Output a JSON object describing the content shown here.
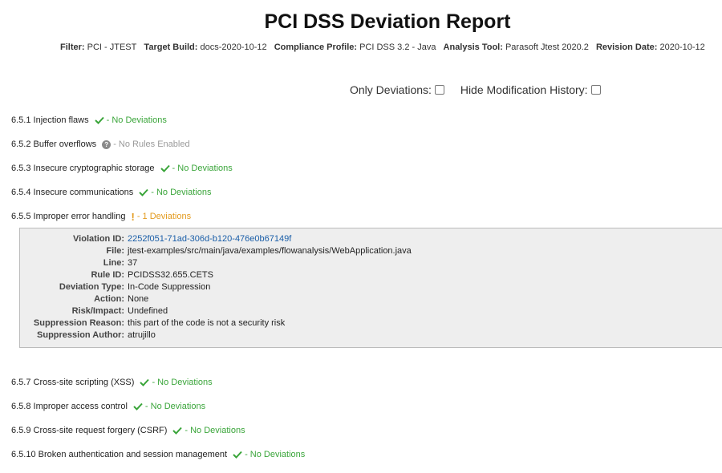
{
  "report": {
    "title": "PCI DSS Deviation Report"
  },
  "meta": [
    {
      "key": "Filter:",
      "value": "PCI - JTEST"
    },
    {
      "key": "Target Build:",
      "value": "docs-2020-10-12"
    },
    {
      "key": "Compliance Profile:",
      "value": "PCI DSS 3.2 - Java"
    },
    {
      "key": "Analysis Tool:",
      "value": "Parasoft Jtest 2020.2"
    },
    {
      "key": "Revision Date:",
      "value": "2020-10-12"
    }
  ],
  "options": {
    "only_deviations": {
      "label": "Only Deviations:",
      "checked": false
    },
    "hide_history": {
      "label": "Hide Modification History:",
      "checked": false
    }
  },
  "requirements": [
    {
      "label": "6.5.1 Injection flaws",
      "status": "- No Deviations",
      "kind": "ok",
      "icon": "check-icon"
    },
    {
      "label": "6.5.2 Buffer overflows",
      "status": "- No Rules Enabled",
      "kind": "none",
      "icon": "help-icon"
    },
    {
      "label": "6.5.3 Insecure cryptographic storage",
      "status": "- No Deviations",
      "kind": "ok",
      "icon": "check-icon"
    },
    {
      "label": "6.5.4 Insecure communications",
      "status": "- No Deviations",
      "kind": "ok",
      "icon": "check-icon"
    },
    {
      "label": "6.5.5 Improper error handling",
      "status": "- 1 Deviations",
      "kind": "warn",
      "icon": "exclamation-icon"
    },
    {
      "label": "6.5.7 Cross-site scripting (XSS)",
      "status": "- No Deviations",
      "kind": "ok",
      "icon": "check-icon"
    },
    {
      "label": "6.5.8 Improper access control",
      "status": "- No Deviations",
      "kind": "ok",
      "icon": "check-icon"
    },
    {
      "label": "6.5.9 Cross-site request forgery (CSRF)",
      "status": "- No Deviations",
      "kind": "ok",
      "icon": "check-icon"
    },
    {
      "label": "6.5.10 Broken authentication and session management",
      "status": "- No Deviations",
      "kind": "ok",
      "icon": "check-icon"
    }
  ],
  "violation": {
    "rows": [
      {
        "key": "Violation ID:",
        "value": "2252f051-71ad-306d-b120-476e0b67149f"
      },
      {
        "key": "File:",
        "value": "jtest-examples/src/main/java/examples/flowanalysis/WebApplication.java"
      },
      {
        "key": "Line:",
        "value": "37"
      },
      {
        "key": "Rule ID:",
        "value": "PCIDSS32.655.CETS"
      },
      {
        "key": "Deviation Type:",
        "value": "In-Code Suppression"
      },
      {
        "key": "Action:",
        "value": "None"
      },
      {
        "key": "Risk/Impact:",
        "value": "Undefined"
      },
      {
        "key": "Suppression Reason:",
        "value": "this part of the code is not a security risk"
      },
      {
        "key": "Suppression Author:",
        "value": "atrujillo"
      }
    ]
  },
  "colors": {
    "ok": "#3aa53a",
    "none": "#999999",
    "warn": "#e39a1d",
    "link": "#1a5ea8"
  }
}
